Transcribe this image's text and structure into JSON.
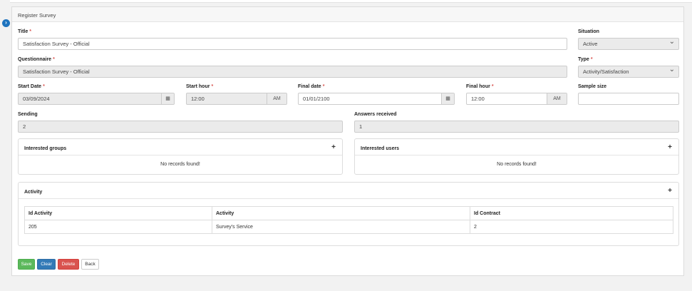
{
  "panel_title": "Register Survey",
  "fields": {
    "title": {
      "label": "Title",
      "value": "Satisfaction Survey - Official"
    },
    "situation": {
      "label": "Situation",
      "value": "Active"
    },
    "questionnaire": {
      "label": "Questionnaire",
      "value": "Satisfaction Survey - Official"
    },
    "type": {
      "label": "Type",
      "value": "Activity/Satisfaction"
    },
    "start_date": {
      "label": "Start Date",
      "value": "03/09/2024"
    },
    "start_hour": {
      "label": "Start hour",
      "value": "12:00",
      "suffix": "AM"
    },
    "final_date": {
      "label": "Final date",
      "value": "01/01/2100"
    },
    "final_hour": {
      "label": "Final hour",
      "value": "12:00",
      "suffix": "AM"
    },
    "sample_size": {
      "label": "Sample size",
      "value": ""
    },
    "sending": {
      "label": "Sending",
      "value": "2"
    },
    "answers_received": {
      "label": "Answers received",
      "value": "1"
    }
  },
  "required_mark": "*",
  "interested_groups": {
    "title": "Interested groups",
    "empty": "No records found!"
  },
  "interested_users": {
    "title": "Interested users",
    "empty": "No records found!"
  },
  "activity": {
    "title": "Activity",
    "columns": [
      "Id Activity",
      "Activity",
      "Id Contract"
    ],
    "rows": [
      [
        "205",
        "Survey's Service",
        "2"
      ]
    ]
  },
  "plus_symbol": "+",
  "buttons": {
    "save": "Save",
    "clear": "Clear",
    "delete": "Delete",
    "back": "Back"
  },
  "icons": {
    "toggle": "chevron-right-icon",
    "calendar": "calendar-icon",
    "add": "plus-icon",
    "dropdown": "chevron-down-icon"
  }
}
